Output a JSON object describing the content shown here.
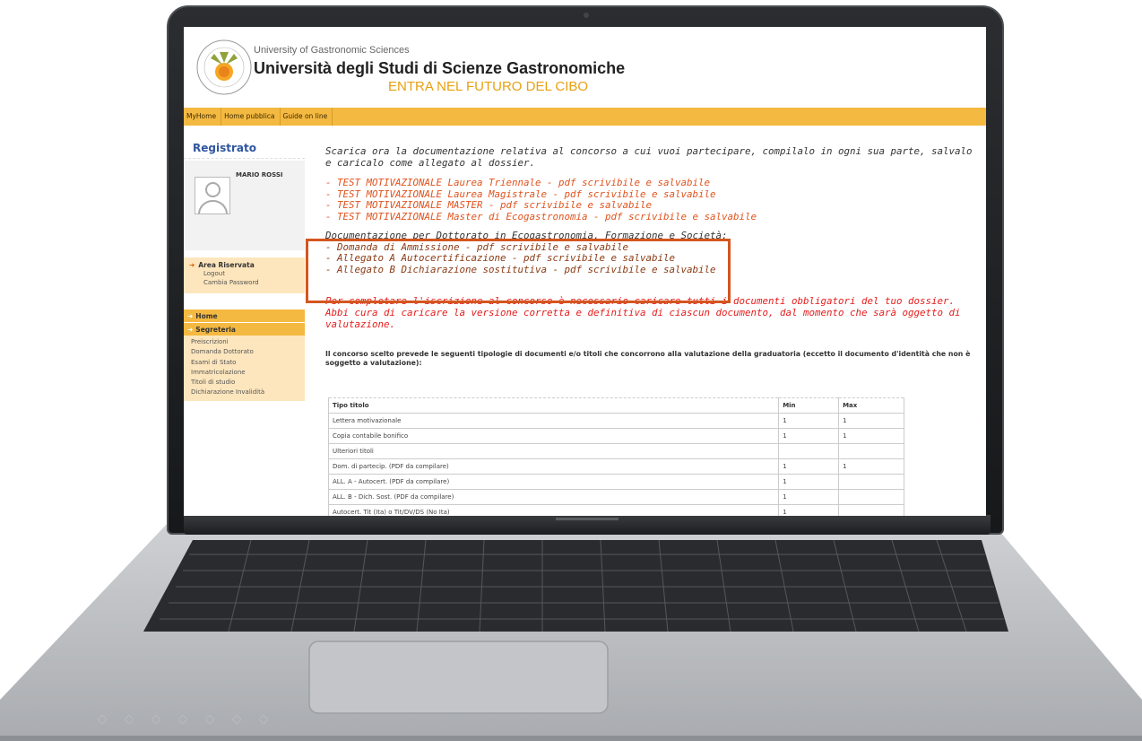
{
  "header": {
    "university_en": "University of Gastronomic Sciences",
    "university_it": "Università degli Studi di Scienze Gastronomiche",
    "tagline": "ENTRA NEL FUTURO DEL CIBO",
    "logo_icon": "university-seal-logo"
  },
  "nav": {
    "items": [
      "MyHome",
      "Home pubblica",
      "Guide on line"
    ]
  },
  "sidebar": {
    "title": "Registrato",
    "username": "MARIO ROSSI",
    "area_title": "Area Riservata",
    "area_links": [
      "Logout",
      "Cambia Password"
    ],
    "home": "Home",
    "segreteria": "Segreteria",
    "segreteria_items": [
      "Preiscrizioni",
      "Domanda Dottorato",
      "Esami di Stato",
      "Immatricolazione",
      "Titoli di studio",
      "Dichiarazione Invalidità"
    ]
  },
  "main": {
    "intro": "Scarica ora la documentazione relativa al concorso a cui vuoi partecipare, compilalo in ogni sua parte, salvalo e caricalo come allegato al dossier.",
    "links": [
      "- TEST MOTIVAZIONALE Laurea Triennale - pdf scrivibile e salvabile",
      "- TEST MOTIVAZIONALE Laurea Magistrale - pdf scrivibile e salvabile",
      "- TEST MOTIVAZIONALE MASTER - pdf scrivibile e salvabile",
      "- TEST MOTIVAZIONALE Master di Ecogastronomia - pdf scrivibile e salvabile"
    ],
    "doc_title": "Documentazione per Dottorato in Ecogastronomia, Formazione e Società:",
    "doc_items": [
      "- Domanda di Ammissione - pdf scrivibile e salvabile",
      "- Allegato A Autocertificazione - pdf scrivibile e salvabile",
      "- Allegato B Dichiarazione sostitutiva - pdf scrivibile e salvabile"
    ],
    "warning": "Per completare l'iscrizione al concorso è necessario caricare tutti i documenti obbligatori del tuo dossier. Abbi cura di caricare la versione corretta e definitiva di ciascun documento, dal momento che sarà oggetto di valutazione.",
    "concorso": "Il concorso scelto prevede le seguenti tipologie di documenti e/o titoli che concorrono alla valutazione della graduatoria (eccetto il documento d'identità che non è soggetto a valutazione):"
  },
  "table": {
    "headers": [
      "Tipo titolo",
      "Min",
      "Max"
    ],
    "rows": [
      [
        "Lettera motivazionale",
        "1",
        "1"
      ],
      [
        "Copia contabile bonifico",
        "1",
        "1"
      ],
      [
        "Ulteriori titoli",
        "",
        ""
      ],
      [
        "Dom. di partecip. (PDF da compilare)",
        "1",
        "1"
      ],
      [
        "ALL. A - Autocert. (PDF da compilare)",
        "1",
        ""
      ],
      [
        "ALL. B - Dich. Sost. (PDF da compilare)",
        "1",
        ""
      ],
      [
        "Autocert. Tit (Ita) o Tit/DV/DS (No Ita)",
        "1",
        ""
      ]
    ]
  },
  "colors": {
    "accent": "#f4b941",
    "link_orange": "#e0531d",
    "warning_red": "#e51b1b",
    "highlight": "#d4561f",
    "sidebar_title": "#2f55a0"
  }
}
